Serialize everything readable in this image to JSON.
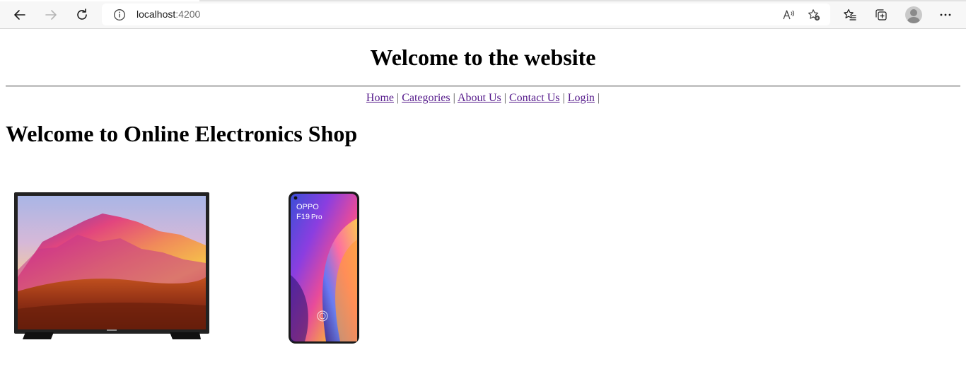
{
  "browser": {
    "url_host": "localhost",
    "url_port": ":4200",
    "icons": [
      "back-icon",
      "forward-icon",
      "refresh-icon",
      "info-icon",
      "read-aloud-icon",
      "add-favorite-icon",
      "favorites-icon",
      "collections-icon",
      "profile-avatar",
      "more-icon"
    ]
  },
  "site": {
    "title": "Welcome to the website",
    "nav": [
      {
        "label": "Home"
      },
      {
        "label": "Categories"
      },
      {
        "label": "About Us"
      },
      {
        "label": "Contact Us"
      },
      {
        "label": "Login"
      }
    ],
    "separator": "|"
  },
  "main": {
    "heading": "Welcome to Online Electronics Shop",
    "products": [
      {
        "name": "television",
        "image": "tv-image"
      },
      {
        "name": "smartphone",
        "image": "phone-image",
        "screen_text_1": "OPPO",
        "screen_text_2": "F19",
        "screen_text_3": "Pro"
      }
    ]
  }
}
